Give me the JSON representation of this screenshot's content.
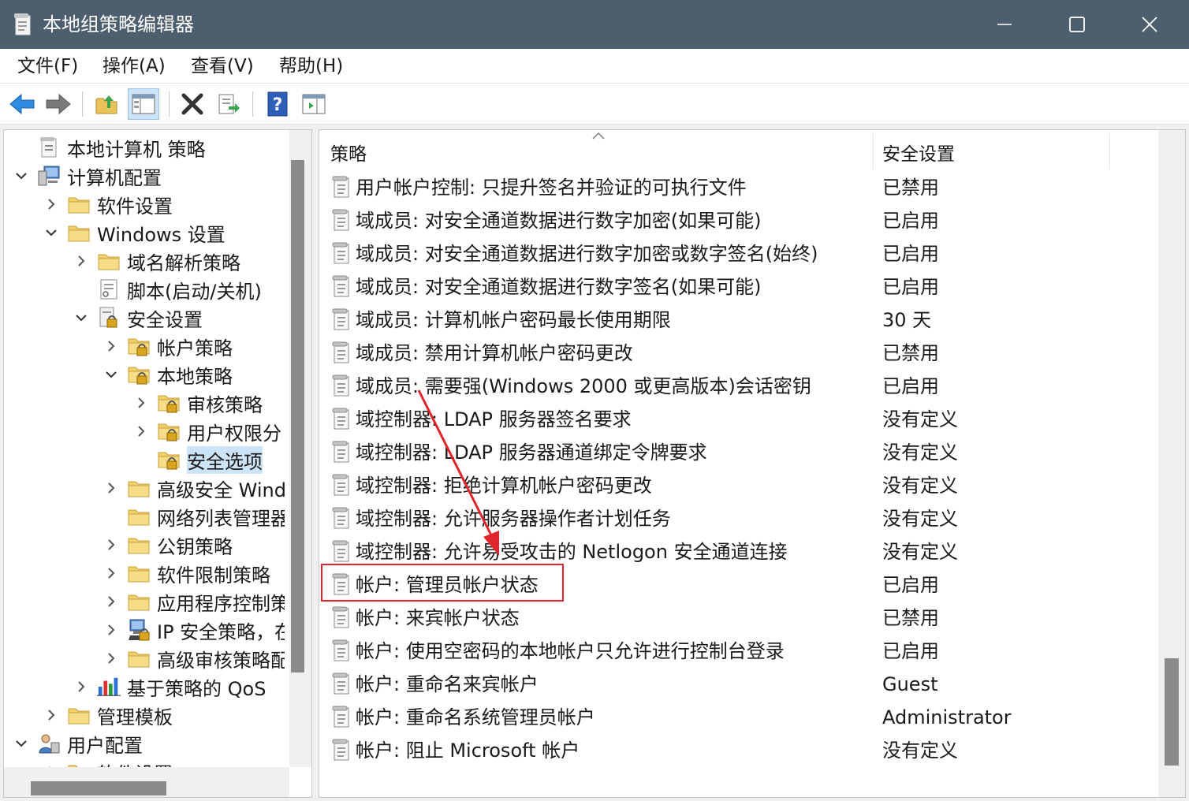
{
  "window": {
    "title": "本地组策略编辑器",
    "icon": "notepad-policy-icon",
    "controls": [
      "minimize-icon",
      "maximize-icon",
      "close-icon"
    ]
  },
  "menu": [
    "文件(F)",
    "操作(A)",
    "查看(V)",
    "帮助(H)"
  ],
  "toolbar": [
    "back-arrow-icon",
    "forward-arrow-icon",
    "up-folder-icon",
    "show-hide-tree-icon",
    "delete-icon",
    "export-list-icon",
    "help-icon",
    "properties-pane-icon"
  ],
  "tree": [
    {
      "label": "本地计算机 策略",
      "level": 0,
      "twisty": "",
      "icon": "policy-doc-icon"
    },
    {
      "label": "计算机配置",
      "level": 0,
      "twisty": "expanded",
      "icon": "computer-icon"
    },
    {
      "label": "软件设置",
      "level": 1,
      "twisty": "collapsed",
      "icon": "folder-icon"
    },
    {
      "label": "Windows 设置",
      "level": 1,
      "twisty": "expanded",
      "icon": "folder-icon"
    },
    {
      "label": "域名解析策略",
      "level": 2,
      "twisty": "collapsed",
      "icon": "folder-icon"
    },
    {
      "label": "脚本(启动/关机)",
      "level": 2,
      "twisty": "",
      "icon": "script-icon"
    },
    {
      "label": "安全设置",
      "level": 2,
      "twisty": "expanded",
      "icon": "security-settings-icon"
    },
    {
      "label": "帐户策略",
      "level": 3,
      "twisty": "collapsed",
      "icon": "locked-folder-icon"
    },
    {
      "label": "本地策略",
      "level": 3,
      "twisty": "expanded",
      "icon": "locked-folder-icon"
    },
    {
      "label": "审核策略",
      "level": 4,
      "twisty": "collapsed",
      "icon": "locked-folder-icon"
    },
    {
      "label": "用户权限分",
      "level": 4,
      "twisty": "collapsed",
      "icon": "locked-folder-icon"
    },
    {
      "label": "安全选项",
      "level": 4,
      "twisty": "",
      "icon": "locked-folder-icon",
      "selected": true
    },
    {
      "label": "高级安全 Wind",
      "level": 3,
      "twisty": "collapsed",
      "icon": "folder-icon"
    },
    {
      "label": "网络列表管理器",
      "level": 3,
      "twisty": "",
      "icon": "folder-icon"
    },
    {
      "label": "公钥策略",
      "level": 3,
      "twisty": "collapsed",
      "icon": "folder-icon"
    },
    {
      "label": "软件限制策略",
      "level": 3,
      "twisty": "collapsed",
      "icon": "folder-icon"
    },
    {
      "label": "应用程序控制策",
      "level": 3,
      "twisty": "collapsed",
      "icon": "folder-icon"
    },
    {
      "label": "IP 安全策略，在",
      "level": 3,
      "twisty": "collapsed",
      "icon": "ip-security-icon"
    },
    {
      "label": "高级审核策略配",
      "level": 3,
      "twisty": "collapsed",
      "icon": "folder-icon"
    },
    {
      "label": "基于策略的 QoS",
      "level": 2,
      "twisty": "collapsed",
      "icon": "qos-chart-icon"
    },
    {
      "label": "管理模板",
      "level": 1,
      "twisty": "collapsed",
      "icon": "folder-icon"
    },
    {
      "label": "用户配置",
      "level": 0,
      "twisty": "expanded",
      "icon": "user-icon"
    },
    {
      "label": "软件设置",
      "level": 1,
      "twisty": "collapsed",
      "icon": "folder-icon"
    }
  ],
  "list": {
    "headers": {
      "policy": "策略",
      "setting": "安全设置"
    },
    "rows": [
      {
        "policy": "用户帐户控制: 只提升签名并验证的可执行文件",
        "setting": "已禁用"
      },
      {
        "policy": "域成员: 对安全通道数据进行数字加密(如果可能)",
        "setting": "已启用"
      },
      {
        "policy": "域成员: 对安全通道数据进行数字加密或数字签名(始终)",
        "setting": "已启用"
      },
      {
        "policy": "域成员: 对安全通道数据进行数字签名(如果可能)",
        "setting": "已启用"
      },
      {
        "policy": "域成员: 计算机帐户密码最长使用期限",
        "setting": "30 天"
      },
      {
        "policy": "域成员: 禁用计算机帐户密码更改",
        "setting": "已禁用"
      },
      {
        "policy": "域成员: 需要强(Windows 2000 或更高版本)会话密钥",
        "setting": "已启用"
      },
      {
        "policy": "域控制器: LDAP 服务器签名要求",
        "setting": "没有定义"
      },
      {
        "policy": "域控制器: LDAP 服务器通道绑定令牌要求",
        "setting": "没有定义"
      },
      {
        "policy": "域控制器: 拒绝计算机帐户密码更改",
        "setting": "没有定义"
      },
      {
        "policy": "域控制器: 允许服务器操作者计划任务",
        "setting": "没有定义"
      },
      {
        "policy": "域控制器: 允许易受攻击的 Netlogon 安全通道连接",
        "setting": "没有定义"
      },
      {
        "policy": "帐户: 管理员帐户状态",
        "setting": "已启用",
        "highlighted": true
      },
      {
        "policy": "帐户: 来宾帐户状态",
        "setting": "已禁用"
      },
      {
        "policy": "帐户: 使用空密码的本地帐户只允许进行控制台登录",
        "setting": "已启用"
      },
      {
        "policy": "帐户: 重命名来宾帐户",
        "setting": "Guest"
      },
      {
        "policy": "帐户: 重命名系统管理员帐户",
        "setting": "Administrator"
      },
      {
        "policy": "帐户: 阻止 Microsoft 帐户",
        "setting": "没有定义"
      }
    ]
  },
  "annotation": {
    "box_color": "#e0262c",
    "arrow_color": "#e0262c"
  }
}
